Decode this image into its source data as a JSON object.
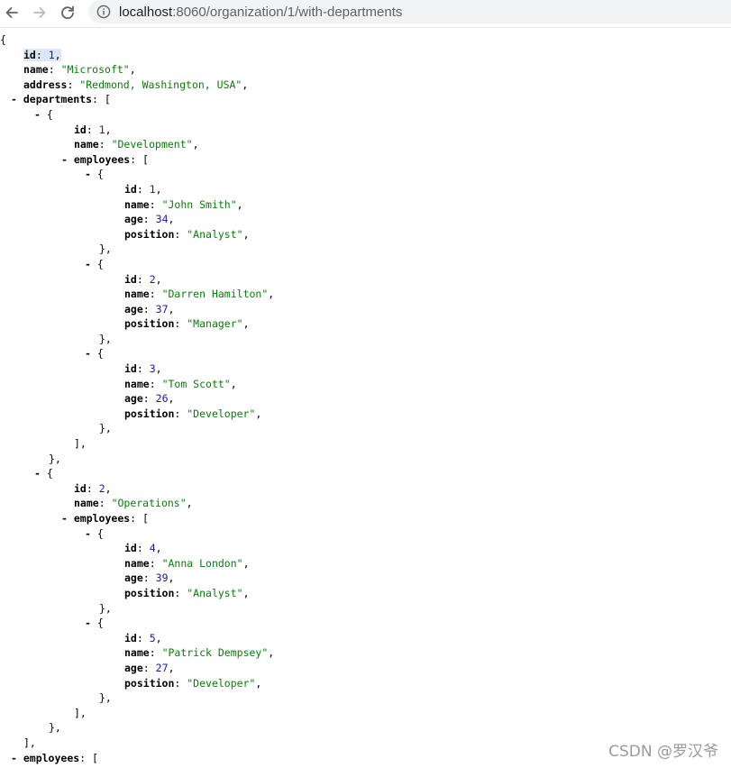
{
  "browser": {
    "url_host": "localhost",
    "url_path": ":8060/organization/1/with-departments",
    "icons": {
      "back": "arrow-left-icon",
      "forward": "arrow-right-icon",
      "reload": "reload-icon",
      "info": "info-icon"
    }
  },
  "colors": {
    "string": "#0b7a0b",
    "number": "#1a1aa6",
    "highlight": "#dce6f5"
  },
  "json_lines": [
    {
      "indent": 0,
      "parts": [
        {
          "t": "p",
          "v": "{"
        }
      ]
    },
    {
      "indent": 26,
      "highlight": true,
      "parts": [
        {
          "t": "k",
          "v": "id"
        },
        {
          "t": "p",
          "v": ": "
        },
        {
          "t": "n",
          "v": "1"
        },
        {
          "t": "p",
          "v": ","
        }
      ]
    },
    {
      "indent": 26,
      "parts": [
        {
          "t": "k",
          "v": "name"
        },
        {
          "t": "p",
          "v": ": "
        },
        {
          "t": "s",
          "v": "\"Microsoft\""
        },
        {
          "t": "p",
          "v": ","
        }
      ]
    },
    {
      "indent": 26,
      "parts": [
        {
          "t": "k",
          "v": "address"
        },
        {
          "t": "p",
          "v": ": "
        },
        {
          "t": "s",
          "v": "\"Redmond, Washington, USA\""
        },
        {
          "t": "p",
          "v": ","
        }
      ]
    },
    {
      "indent": 12,
      "parts": [
        {
          "t": "toggle",
          "v": "- "
        },
        {
          "t": "k",
          "v": "departments"
        },
        {
          "t": "p",
          "v": ": ["
        }
      ]
    },
    {
      "indent": 38,
      "parts": [
        {
          "t": "toggle",
          "v": "- "
        },
        {
          "t": "p",
          "v": "{"
        }
      ]
    },
    {
      "indent": 82,
      "parts": [
        {
          "t": "k",
          "v": "id"
        },
        {
          "t": "p",
          "v": ": "
        },
        {
          "t": "n",
          "v": "1"
        },
        {
          "t": "p",
          "v": ","
        }
      ]
    },
    {
      "indent": 82,
      "parts": [
        {
          "t": "k",
          "v": "name"
        },
        {
          "t": "p",
          "v": ": "
        },
        {
          "t": "s",
          "v": "\"Development\""
        },
        {
          "t": "p",
          "v": ","
        }
      ]
    },
    {
      "indent": 68,
      "parts": [
        {
          "t": "toggle",
          "v": "- "
        },
        {
          "t": "k",
          "v": "employees"
        },
        {
          "t": "p",
          "v": ": ["
        }
      ]
    },
    {
      "indent": 94,
      "parts": [
        {
          "t": "toggle",
          "v": "- "
        },
        {
          "t": "p",
          "v": "{"
        }
      ]
    },
    {
      "indent": 138,
      "parts": [
        {
          "t": "k",
          "v": "id"
        },
        {
          "t": "p",
          "v": ": "
        },
        {
          "t": "n",
          "v": "1"
        },
        {
          "t": "p",
          "v": ","
        }
      ]
    },
    {
      "indent": 138,
      "parts": [
        {
          "t": "k",
          "v": "name"
        },
        {
          "t": "p",
          "v": ": "
        },
        {
          "t": "s",
          "v": "\"John Smith\""
        },
        {
          "t": "p",
          "v": ","
        }
      ]
    },
    {
      "indent": 138,
      "parts": [
        {
          "t": "k",
          "v": "age"
        },
        {
          "t": "p",
          "v": ": "
        },
        {
          "t": "n",
          "v": "34"
        },
        {
          "t": "p",
          "v": ","
        }
      ]
    },
    {
      "indent": 138,
      "parts": [
        {
          "t": "k",
          "v": "position"
        },
        {
          "t": "p",
          "v": ": "
        },
        {
          "t": "s",
          "v": "\"Analyst\""
        },
        {
          "t": "p",
          "v": ","
        }
      ]
    },
    {
      "indent": 110,
      "parts": [
        {
          "t": "p",
          "v": "},"
        }
      ]
    },
    {
      "indent": 94,
      "parts": [
        {
          "t": "toggle",
          "v": "- "
        },
        {
          "t": "p",
          "v": "{"
        }
      ]
    },
    {
      "indent": 138,
      "parts": [
        {
          "t": "k",
          "v": "id"
        },
        {
          "t": "p",
          "v": ": "
        },
        {
          "t": "n",
          "v": "2"
        },
        {
          "t": "p",
          "v": ","
        }
      ]
    },
    {
      "indent": 138,
      "parts": [
        {
          "t": "k",
          "v": "name"
        },
        {
          "t": "p",
          "v": ": "
        },
        {
          "t": "s",
          "v": "\"Darren Hamilton\""
        },
        {
          "t": "p",
          "v": ","
        }
      ]
    },
    {
      "indent": 138,
      "parts": [
        {
          "t": "k",
          "v": "age"
        },
        {
          "t": "p",
          "v": ": "
        },
        {
          "t": "n",
          "v": "37"
        },
        {
          "t": "p",
          "v": ","
        }
      ]
    },
    {
      "indent": 138,
      "parts": [
        {
          "t": "k",
          "v": "position"
        },
        {
          "t": "p",
          "v": ": "
        },
        {
          "t": "s",
          "v": "\"Manager\""
        },
        {
          "t": "p",
          "v": ","
        }
      ]
    },
    {
      "indent": 110,
      "parts": [
        {
          "t": "p",
          "v": "},"
        }
      ]
    },
    {
      "indent": 94,
      "parts": [
        {
          "t": "toggle",
          "v": "- "
        },
        {
          "t": "p",
          "v": "{"
        }
      ]
    },
    {
      "indent": 138,
      "parts": [
        {
          "t": "k",
          "v": "id"
        },
        {
          "t": "p",
          "v": ": "
        },
        {
          "t": "n",
          "v": "3"
        },
        {
          "t": "p",
          "v": ","
        }
      ]
    },
    {
      "indent": 138,
      "parts": [
        {
          "t": "k",
          "v": "name"
        },
        {
          "t": "p",
          "v": ": "
        },
        {
          "t": "s",
          "v": "\"Tom Scott\""
        },
        {
          "t": "p",
          "v": ","
        }
      ]
    },
    {
      "indent": 138,
      "parts": [
        {
          "t": "k",
          "v": "age"
        },
        {
          "t": "p",
          "v": ": "
        },
        {
          "t": "n",
          "v": "26"
        },
        {
          "t": "p",
          "v": ","
        }
      ]
    },
    {
      "indent": 138,
      "parts": [
        {
          "t": "k",
          "v": "position"
        },
        {
          "t": "p",
          "v": ": "
        },
        {
          "t": "s",
          "v": "\"Developer\""
        },
        {
          "t": "p",
          "v": ","
        }
      ]
    },
    {
      "indent": 110,
      "parts": [
        {
          "t": "p",
          "v": "},"
        }
      ]
    },
    {
      "indent": 82,
      "parts": [
        {
          "t": "p",
          "v": "],"
        }
      ]
    },
    {
      "indent": 54,
      "parts": [
        {
          "t": "p",
          "v": "},"
        }
      ]
    },
    {
      "indent": 38,
      "parts": [
        {
          "t": "toggle",
          "v": "- "
        },
        {
          "t": "p",
          "v": "{"
        }
      ]
    },
    {
      "indent": 82,
      "parts": [
        {
          "t": "k",
          "v": "id"
        },
        {
          "t": "p",
          "v": ": "
        },
        {
          "t": "n",
          "v": "2"
        },
        {
          "t": "p",
          "v": ","
        }
      ]
    },
    {
      "indent": 82,
      "parts": [
        {
          "t": "k",
          "v": "name"
        },
        {
          "t": "p",
          "v": ": "
        },
        {
          "t": "s",
          "v": "\"Operations\""
        },
        {
          "t": "p",
          "v": ","
        }
      ]
    },
    {
      "indent": 68,
      "parts": [
        {
          "t": "toggle",
          "v": "- "
        },
        {
          "t": "k",
          "v": "employees"
        },
        {
          "t": "p",
          "v": ": ["
        }
      ]
    },
    {
      "indent": 94,
      "parts": [
        {
          "t": "toggle",
          "v": "- "
        },
        {
          "t": "p",
          "v": "{"
        }
      ]
    },
    {
      "indent": 138,
      "parts": [
        {
          "t": "k",
          "v": "id"
        },
        {
          "t": "p",
          "v": ": "
        },
        {
          "t": "n",
          "v": "4"
        },
        {
          "t": "p",
          "v": ","
        }
      ]
    },
    {
      "indent": 138,
      "parts": [
        {
          "t": "k",
          "v": "name"
        },
        {
          "t": "p",
          "v": ": "
        },
        {
          "t": "s",
          "v": "\"Anna London\""
        },
        {
          "t": "p",
          "v": ","
        }
      ]
    },
    {
      "indent": 138,
      "parts": [
        {
          "t": "k",
          "v": "age"
        },
        {
          "t": "p",
          "v": ": "
        },
        {
          "t": "n",
          "v": "39"
        },
        {
          "t": "p",
          "v": ","
        }
      ]
    },
    {
      "indent": 138,
      "parts": [
        {
          "t": "k",
          "v": "position"
        },
        {
          "t": "p",
          "v": ": "
        },
        {
          "t": "s",
          "v": "\"Analyst\""
        },
        {
          "t": "p",
          "v": ","
        }
      ]
    },
    {
      "indent": 110,
      "parts": [
        {
          "t": "p",
          "v": "},"
        }
      ]
    },
    {
      "indent": 94,
      "parts": [
        {
          "t": "toggle",
          "v": "- "
        },
        {
          "t": "p",
          "v": "{"
        }
      ]
    },
    {
      "indent": 138,
      "parts": [
        {
          "t": "k",
          "v": "id"
        },
        {
          "t": "p",
          "v": ": "
        },
        {
          "t": "n",
          "v": "5"
        },
        {
          "t": "p",
          "v": ","
        }
      ]
    },
    {
      "indent": 138,
      "parts": [
        {
          "t": "k",
          "v": "name"
        },
        {
          "t": "p",
          "v": ": "
        },
        {
          "t": "s",
          "v": "\"Patrick Dempsey\""
        },
        {
          "t": "p",
          "v": ","
        }
      ]
    },
    {
      "indent": 138,
      "parts": [
        {
          "t": "k",
          "v": "age"
        },
        {
          "t": "p",
          "v": ": "
        },
        {
          "t": "n",
          "v": "27"
        },
        {
          "t": "p",
          "v": ","
        }
      ]
    },
    {
      "indent": 138,
      "parts": [
        {
          "t": "k",
          "v": "position"
        },
        {
          "t": "p",
          "v": ": "
        },
        {
          "t": "s",
          "v": "\"Developer\""
        },
        {
          "t": "p",
          "v": ","
        }
      ]
    },
    {
      "indent": 110,
      "parts": [
        {
          "t": "p",
          "v": "},"
        }
      ]
    },
    {
      "indent": 82,
      "parts": [
        {
          "t": "p",
          "v": "],"
        }
      ]
    },
    {
      "indent": 54,
      "parts": [
        {
          "t": "p",
          "v": "},"
        }
      ]
    },
    {
      "indent": 26,
      "parts": [
        {
          "t": "p",
          "v": "],"
        }
      ]
    },
    {
      "indent": 12,
      "parts": [
        {
          "t": "toggle",
          "v": "- "
        },
        {
          "t": "k",
          "v": "employees"
        },
        {
          "t": "p",
          "v": ": ["
        }
      ]
    }
  ],
  "watermark": "CSDN @罗汉爷"
}
